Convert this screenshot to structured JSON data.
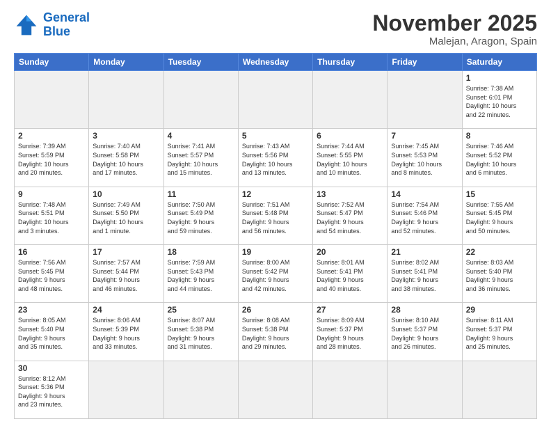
{
  "header": {
    "logo_general": "General",
    "logo_blue": "Blue",
    "title": "November 2025",
    "subtitle": "Malejan, Aragon, Spain"
  },
  "weekdays": [
    "Sunday",
    "Monday",
    "Tuesday",
    "Wednesday",
    "Thursday",
    "Friday",
    "Saturday"
  ],
  "days": [
    {
      "num": "",
      "info": "",
      "empty": true
    },
    {
      "num": "",
      "info": "",
      "empty": true
    },
    {
      "num": "",
      "info": "",
      "empty": true
    },
    {
      "num": "",
      "info": "",
      "empty": true
    },
    {
      "num": "",
      "info": "",
      "empty": true
    },
    {
      "num": "",
      "info": "",
      "empty": true
    },
    {
      "num": "1",
      "info": "Sunrise: 7:38 AM\nSunset: 6:01 PM\nDaylight: 10 hours\nand 22 minutes."
    }
  ],
  "week2": [
    {
      "num": "2",
      "info": "Sunrise: 7:39 AM\nSunset: 5:59 PM\nDaylight: 10 hours\nand 20 minutes."
    },
    {
      "num": "3",
      "info": "Sunrise: 7:40 AM\nSunset: 5:58 PM\nDaylight: 10 hours\nand 17 minutes."
    },
    {
      "num": "4",
      "info": "Sunrise: 7:41 AM\nSunset: 5:57 PM\nDaylight: 10 hours\nand 15 minutes."
    },
    {
      "num": "5",
      "info": "Sunrise: 7:43 AM\nSunset: 5:56 PM\nDaylight: 10 hours\nand 13 minutes."
    },
    {
      "num": "6",
      "info": "Sunrise: 7:44 AM\nSunset: 5:55 PM\nDaylight: 10 hours\nand 10 minutes."
    },
    {
      "num": "7",
      "info": "Sunrise: 7:45 AM\nSunset: 5:53 PM\nDaylight: 10 hours\nand 8 minutes."
    },
    {
      "num": "8",
      "info": "Sunrise: 7:46 AM\nSunset: 5:52 PM\nDaylight: 10 hours\nand 6 minutes."
    }
  ],
  "week3": [
    {
      "num": "9",
      "info": "Sunrise: 7:48 AM\nSunset: 5:51 PM\nDaylight: 10 hours\nand 3 minutes."
    },
    {
      "num": "10",
      "info": "Sunrise: 7:49 AM\nSunset: 5:50 PM\nDaylight: 10 hours\nand 1 minute."
    },
    {
      "num": "11",
      "info": "Sunrise: 7:50 AM\nSunset: 5:49 PM\nDaylight: 9 hours\nand 59 minutes."
    },
    {
      "num": "12",
      "info": "Sunrise: 7:51 AM\nSunset: 5:48 PM\nDaylight: 9 hours\nand 56 minutes."
    },
    {
      "num": "13",
      "info": "Sunrise: 7:52 AM\nSunset: 5:47 PM\nDaylight: 9 hours\nand 54 minutes."
    },
    {
      "num": "14",
      "info": "Sunrise: 7:54 AM\nSunset: 5:46 PM\nDaylight: 9 hours\nand 52 minutes."
    },
    {
      "num": "15",
      "info": "Sunrise: 7:55 AM\nSunset: 5:45 PM\nDaylight: 9 hours\nand 50 minutes."
    }
  ],
  "week4": [
    {
      "num": "16",
      "info": "Sunrise: 7:56 AM\nSunset: 5:45 PM\nDaylight: 9 hours\nand 48 minutes."
    },
    {
      "num": "17",
      "info": "Sunrise: 7:57 AM\nSunset: 5:44 PM\nDaylight: 9 hours\nand 46 minutes."
    },
    {
      "num": "18",
      "info": "Sunrise: 7:59 AM\nSunset: 5:43 PM\nDaylight: 9 hours\nand 44 minutes."
    },
    {
      "num": "19",
      "info": "Sunrise: 8:00 AM\nSunset: 5:42 PM\nDaylight: 9 hours\nand 42 minutes."
    },
    {
      "num": "20",
      "info": "Sunrise: 8:01 AM\nSunset: 5:41 PM\nDaylight: 9 hours\nand 40 minutes."
    },
    {
      "num": "21",
      "info": "Sunrise: 8:02 AM\nSunset: 5:41 PM\nDaylight: 9 hours\nand 38 minutes."
    },
    {
      "num": "22",
      "info": "Sunrise: 8:03 AM\nSunset: 5:40 PM\nDaylight: 9 hours\nand 36 minutes."
    }
  ],
  "week5": [
    {
      "num": "23",
      "info": "Sunrise: 8:05 AM\nSunset: 5:40 PM\nDaylight: 9 hours\nand 35 minutes."
    },
    {
      "num": "24",
      "info": "Sunrise: 8:06 AM\nSunset: 5:39 PM\nDaylight: 9 hours\nand 33 minutes."
    },
    {
      "num": "25",
      "info": "Sunrise: 8:07 AM\nSunset: 5:38 PM\nDaylight: 9 hours\nand 31 minutes."
    },
    {
      "num": "26",
      "info": "Sunrise: 8:08 AM\nSunset: 5:38 PM\nDaylight: 9 hours\nand 29 minutes."
    },
    {
      "num": "27",
      "info": "Sunrise: 8:09 AM\nSunset: 5:37 PM\nDaylight: 9 hours\nand 28 minutes."
    },
    {
      "num": "28",
      "info": "Sunrise: 8:10 AM\nSunset: 5:37 PM\nDaylight: 9 hours\nand 26 minutes."
    },
    {
      "num": "29",
      "info": "Sunrise: 8:11 AM\nSunset: 5:37 PM\nDaylight: 9 hours\nand 25 minutes."
    }
  ],
  "week6": [
    {
      "num": "30",
      "info": "Sunrise: 8:12 AM\nSunset: 5:36 PM\nDaylight: 9 hours\nand 23 minutes."
    },
    {
      "num": "",
      "info": "",
      "empty": true
    },
    {
      "num": "",
      "info": "",
      "empty": true
    },
    {
      "num": "",
      "info": "",
      "empty": true
    },
    {
      "num": "",
      "info": "",
      "empty": true
    },
    {
      "num": "",
      "info": "",
      "empty": true
    },
    {
      "num": "",
      "info": "",
      "empty": true
    }
  ]
}
